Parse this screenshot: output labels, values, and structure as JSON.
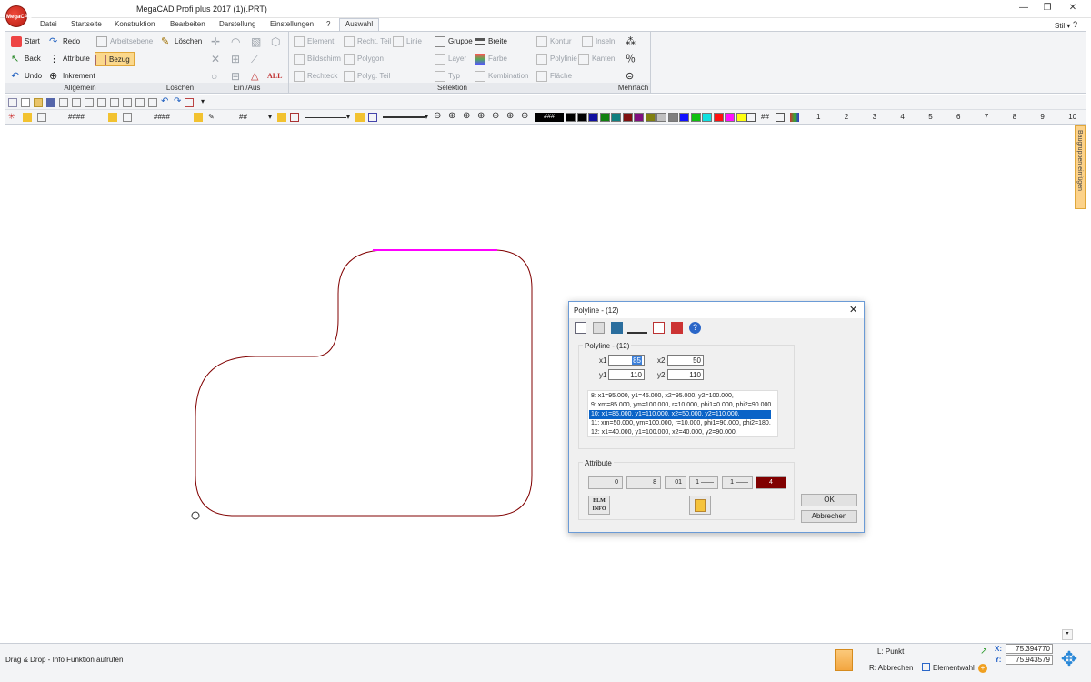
{
  "window": {
    "title": "MegaCAD Profi plus 2017 (1)(.PRT)",
    "logo_text": "MegaCAD",
    "minimize": "—",
    "restore": "❐",
    "close": "✕"
  },
  "tabs": [
    "Datei",
    "Startseite",
    "Konstruktion",
    "Bearbeiten",
    "Darstellung",
    "Einstellungen",
    "?",
    "Auswahl"
  ],
  "contextual_badge": "—",
  "stil": "Stil",
  "ribbon": {
    "allgemein": {
      "label": "Allgemein",
      "buttons": [
        "Start",
        "Redo",
        "Arbeitsebene",
        "Back",
        "Attribute",
        "Bezug",
        "Undo",
        "Inkrement"
      ]
    },
    "loeschen": {
      "label": "Löschen",
      "button": "Löschen"
    },
    "ein_aus": {
      "label": "Ein /Aus",
      "text": "ALL"
    },
    "selektion": {
      "label": "Selektion",
      "buttons": [
        "Element",
        "Recht. Teil",
        "Linie",
        "Gruppe",
        "Breite",
        "Kontur",
        "Inseln",
        "Bildschirm",
        "Polygon",
        "Layer",
        "Farbe",
        "Polylinie",
        "Kanten",
        "Rechteck",
        "Polyg. Teil",
        "Typ",
        "Kombination",
        "Fläche"
      ]
    },
    "mehrfach": {
      "label": "Mehrfach"
    }
  },
  "toolbar2": {
    "field1": "####",
    "field2": "####",
    "field3": "##",
    "color_field": "###",
    "numbers": [
      "1",
      "2",
      "3",
      "4",
      "5",
      "6",
      "7",
      "8",
      "9",
      "10"
    ],
    "colors": [
      "#000000",
      "#000000",
      "#1010a0",
      "#108010",
      "#108080",
      "#801010",
      "#801080",
      "#808010",
      "#c0c0c0",
      "#808080",
      "#1010ff",
      "#10c010",
      "#10e0e0",
      "#ff1010",
      "#ff10ff",
      "#ffff10"
    ]
  },
  "side_tab": "Baugruppen einfügen",
  "dialog": {
    "title": "Polyline - (12)",
    "close": "✕",
    "group_label": "Polyline - (12)",
    "x1_label": "x1",
    "x1_value": "85",
    "x2_label": "x2",
    "x2_value": "50",
    "y1_label": "y1",
    "y1_value": "110",
    "y2_label": "y2",
    "y2_value": "110",
    "list": [
      "8: x1=95.000, y1=45.000, x2=95.000, y2=100.000,",
      "9: xm=85.000, ym=100.000, r=10.000, phi1=0.000, phi2=90.000,",
      "10: x1=85.000, y1=110.000, x2=50.000, y2=110.000,",
      "11: xm=50.000, ym=100.000, r=10.000, phi1=90.000, phi2=180.000,",
      "12: x1=40.000, y1=100.000, x2=40.000, y2=90.000,"
    ],
    "attr_label": "Attribute",
    "attr_values": [
      "0",
      "8",
      "01",
      "1",
      "1",
      "4"
    ],
    "elm_info": "ELM INFO",
    "ok": "OK",
    "cancel": "Abbrechen"
  },
  "status": {
    "text": "Drag & Drop - Info Funktion aufrufen",
    "left_hint": "L: Punkt",
    "right_hint": "R: Abbrechen",
    "element_select": "Elementwahl",
    "x_label": "X:",
    "x_value": "75.394770",
    "y_label": "Y:",
    "y_value": "75.943579"
  }
}
